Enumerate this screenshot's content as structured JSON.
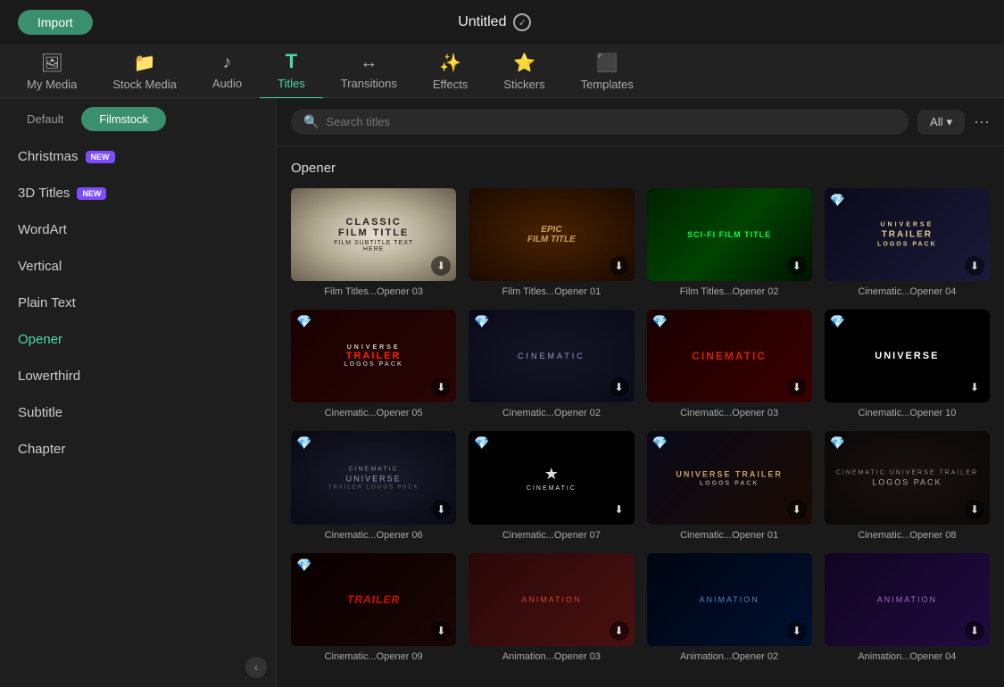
{
  "topbar": {
    "import_label": "Import",
    "title": "Untitled"
  },
  "nav": {
    "tabs": [
      {
        "id": "my-media",
        "label": "My Media",
        "icon": "🖼"
      },
      {
        "id": "stock-media",
        "label": "Stock Media",
        "icon": "📁"
      },
      {
        "id": "audio",
        "label": "Audio",
        "icon": "♪"
      },
      {
        "id": "titles",
        "label": "Titles",
        "icon": "T",
        "active": true
      },
      {
        "id": "transitions",
        "label": "Transitions",
        "icon": "↔"
      },
      {
        "id": "effects",
        "label": "Effects",
        "icon": "✨"
      },
      {
        "id": "stickers",
        "label": "Stickers",
        "icon": "⭐"
      },
      {
        "id": "templates",
        "label": "Templates",
        "icon": "⬛"
      }
    ]
  },
  "sidebar": {
    "tab_default": "Default",
    "tab_filmstock": "Filmstock",
    "items": [
      {
        "id": "christmas",
        "label": "Christmas",
        "badge": "NEW"
      },
      {
        "id": "3d-titles",
        "label": "3D Titles",
        "badge": "NEW"
      },
      {
        "id": "wordart",
        "label": "WordArt"
      },
      {
        "id": "vertical",
        "label": "Vertical"
      },
      {
        "id": "plain-text",
        "label": "Plain Text"
      },
      {
        "id": "opener",
        "label": "Opener",
        "active": true
      },
      {
        "id": "lowerthird",
        "label": "Lowerthird"
      },
      {
        "id": "subtitle",
        "label": "Subtitle"
      },
      {
        "id": "chapter",
        "label": "Chapter"
      }
    ]
  },
  "search": {
    "placeholder": "Search titles",
    "filter_label": "All"
  },
  "section": {
    "label": "Opener"
  },
  "grid": {
    "items": [
      {
        "id": "film-opener-03",
        "label": "Film Titles...Opener 03",
        "type": "classic-film",
        "has_gem": false,
        "has_download": true
      },
      {
        "id": "film-opener-01",
        "label": "Film Titles...Opener 01",
        "type": "epic",
        "has_gem": false,
        "has_download": true
      },
      {
        "id": "film-opener-02",
        "label": "Film Titles...Opener 02",
        "type": "scifi",
        "has_gem": false,
        "has_download": true
      },
      {
        "id": "cinematic-opener-04",
        "label": "Cinematic...Opener 04",
        "type": "universe-dark",
        "has_gem": true,
        "has_download": true
      },
      {
        "id": "cinematic-opener-05",
        "label": "Cinematic...Opener 05",
        "type": "trailer-red",
        "has_gem": true,
        "has_download": true
      },
      {
        "id": "cinematic-opener-02",
        "label": "Cinematic...Opener 02",
        "type": "cinematic-blue",
        "has_gem": true,
        "has_download": true
      },
      {
        "id": "cinematic-opener-03",
        "label": "Cinematic...Opener 03",
        "type": "cinematic-red",
        "has_gem": true,
        "has_download": true
      },
      {
        "id": "cinematic-opener-10",
        "label": "Cinematic...Opener 10",
        "type": "universe-black",
        "has_gem": true,
        "has_download": true
      },
      {
        "id": "cinematic-opener-06",
        "label": "Cinematic...Opener 06",
        "type": "cinematic-universe",
        "has_gem": true,
        "has_download": true
      },
      {
        "id": "cinematic-opener-07",
        "label": "Cinematic...Opener 07",
        "type": "cinematic-star",
        "has_gem": true,
        "has_download": true
      },
      {
        "id": "cinematic-opener-01",
        "label": "Cinematic...Opener 01",
        "type": "universe-trailer",
        "has_gem": true,
        "has_download": true
      },
      {
        "id": "cinematic-opener-08",
        "label": "Cinematic...Opener 08",
        "type": "logos-pack",
        "has_gem": true,
        "has_download": true
      },
      {
        "id": "row3-1",
        "label": "Cinematic...Opener 09",
        "type": "dark-trailer",
        "has_gem": true,
        "has_download": true
      },
      {
        "id": "row3-2",
        "label": "Animation...Opener 03",
        "type": "animation-red",
        "has_gem": false,
        "has_download": true
      },
      {
        "id": "row3-3",
        "label": "Animation...Opener 02",
        "type": "animation-blue",
        "has_gem": false,
        "has_download": true
      },
      {
        "id": "row3-4",
        "label": "Animation...Opener 04",
        "type": "animation-purple",
        "has_gem": false,
        "has_download": true
      }
    ]
  }
}
